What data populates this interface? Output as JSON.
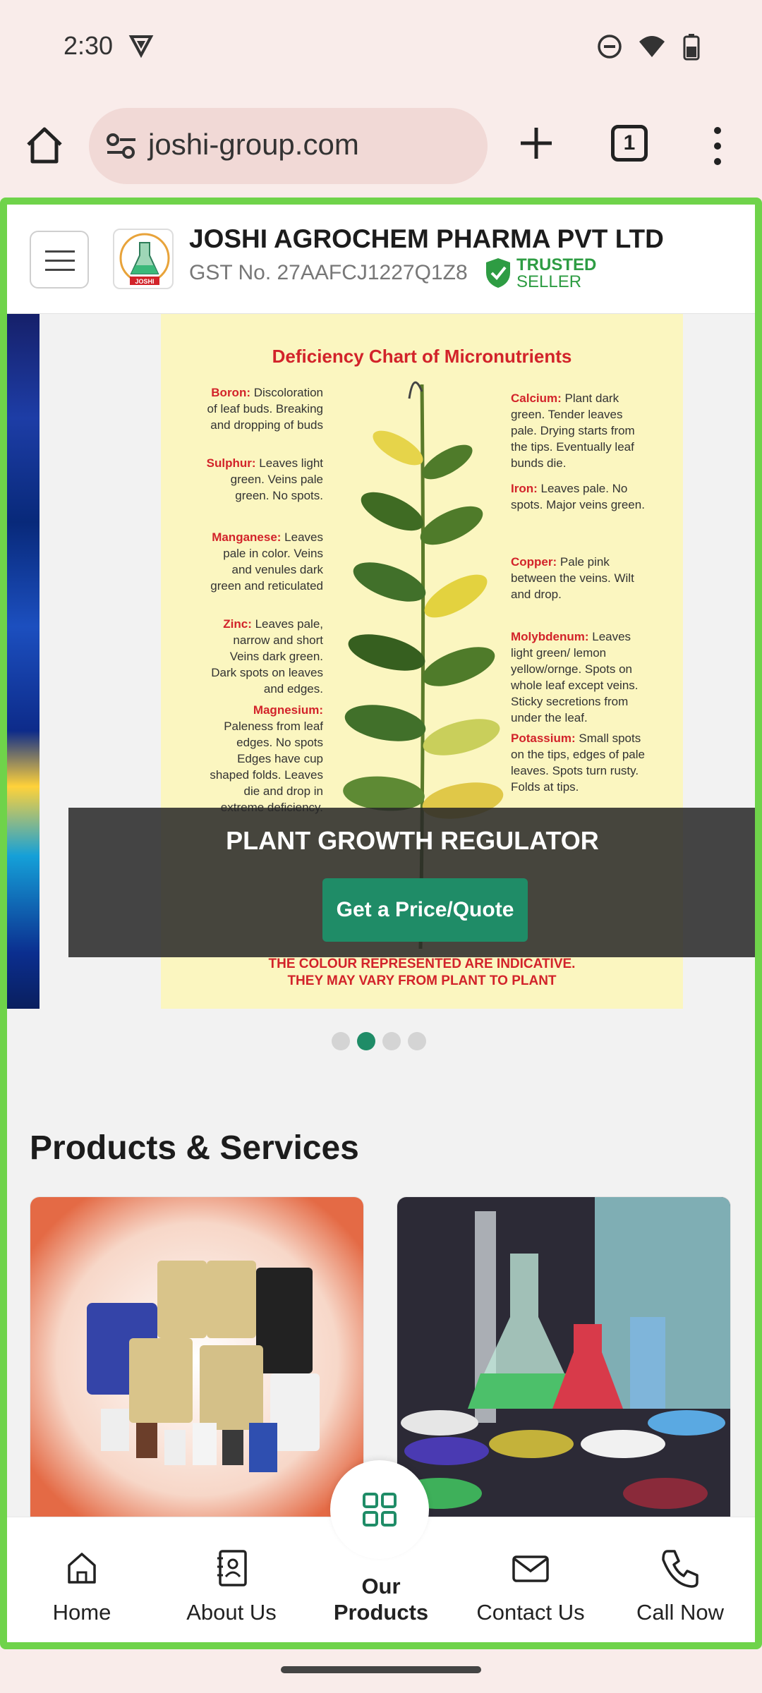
{
  "status_bar": {
    "time": "2:30",
    "icons": [
      "vpn-badge-icon",
      "dnd-icon",
      "wifi-icon",
      "battery-icon"
    ]
  },
  "browser": {
    "url": "joshi-group.com",
    "tab_count": "1"
  },
  "header": {
    "company_name": "JOSHI AGROCHEM PHARMA PVT LTD",
    "gst": "GST No. 27AAFCJ1227Q1Z8",
    "trusted_line1": "TRUSTED",
    "trusted_line2": "SELLER",
    "logo_text": "JOSHI"
  },
  "banner": {
    "chart_title": "Deficiency Chart of Micronutrients",
    "left_notes": [
      {
        "name": "Boron:",
        "text": "Discoloration of leaf buds. Breaking and dropping of buds"
      },
      {
        "name": "Sulphur:",
        "text": "Leaves light green. Veins pale green. No spots."
      },
      {
        "name": "Manganese:",
        "text": "Leaves pale in color. Veins and venules dark green and reticulated"
      },
      {
        "name": "Zinc:",
        "text": "Leaves pale, narrow and short Veins dark green. Dark spots on leaves and edges."
      },
      {
        "name": "Magnesium:",
        "text": "Paleness from leaf edges. No spots Edges have cup shaped folds. Leaves die and drop in extreme deficiency."
      }
    ],
    "right_notes": [
      {
        "name": "Calcium:",
        "text": "Plant dark green. Tender leaves pale. Drying starts from the tips. Eventually leaf bunds die."
      },
      {
        "name": "Iron:",
        "text": "Leaves pale. No spots. Major veins green."
      },
      {
        "name": "Copper:",
        "text": "Pale pink between the veins. Wilt and drop."
      },
      {
        "name": "Molybdenum:",
        "text": "Leaves light green/ lemon yellow/ornge. Spots on whole leaf except veins. Sticky secretions from under the leaf."
      },
      {
        "name": "Potassium:",
        "text": "Small spots on the tips, edges of pale leaves. Spots turn rusty. Folds at tips."
      }
    ],
    "chart_footer_1": "THE COLOUR REPRESENTED ARE INDICATIVE.",
    "chart_footer_2": "THEY MAY VARY FROM PLANT TO PLANT",
    "overlay_title": "PLANT GROWTH REGULATOR",
    "quote_button": "Get a Price/Quote",
    "active_slide": 2,
    "slide_count": 4
  },
  "products": {
    "section_title": "Products & Services"
  },
  "bottom_nav": {
    "home": "Home",
    "about": "About Us",
    "products_line1": "Our",
    "products_line2": "Products",
    "contact": "Contact Us",
    "call": "Call Now"
  },
  "colors": {
    "brand_green": "#1f8c67",
    "frame_green": "#6fd34a",
    "chart_red": "#d2232a"
  }
}
